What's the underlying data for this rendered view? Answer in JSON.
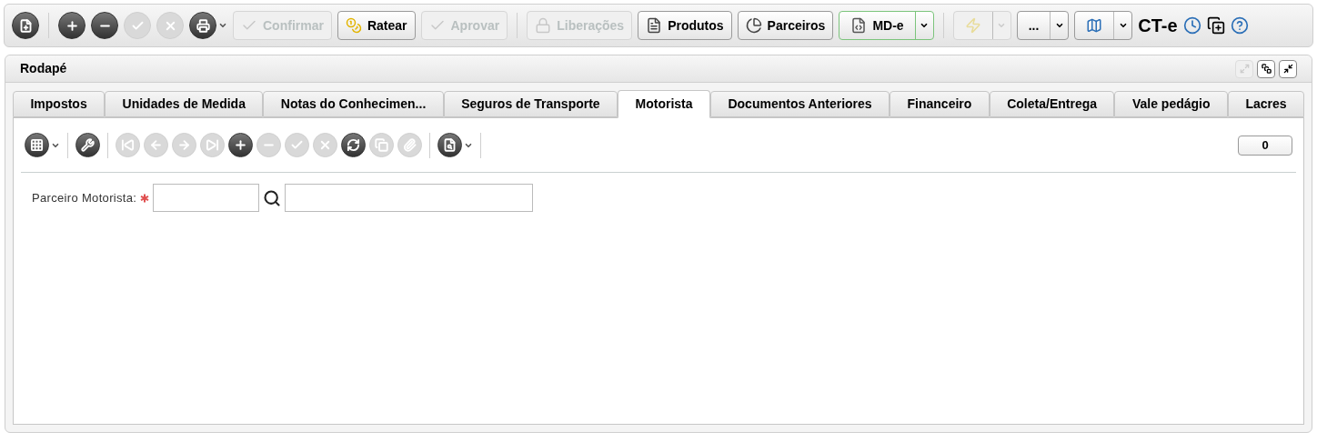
{
  "toolbar": {
    "items": [
      {
        "kind": "icon",
        "disabled": false
      },
      {
        "kind": "separator"
      },
      {
        "kind": "icon",
        "disabled": false
      },
      {
        "kind": "icon",
        "disabled": false
      },
      {
        "kind": "icon",
        "disabled": true
      },
      {
        "kind": "icon",
        "disabled": true
      },
      {
        "kind": "menu-icon",
        "disabled": false
      },
      {
        "kind": "button",
        "label": "Confirmar",
        "disabled": true
      },
      {
        "kind": "button",
        "label": "Ratear",
        "disabled": false
      },
      {
        "kind": "button",
        "label": "Aprovar",
        "disabled": true
      },
      {
        "kind": "separator"
      },
      {
        "kind": "button",
        "label": "Liberações",
        "disabled": true
      },
      {
        "kind": "button",
        "label": "Produtos",
        "disabled": false
      },
      {
        "kind": "button",
        "label": "Parceiros",
        "disabled": false
      },
      {
        "kind": "split",
        "label": "MD-e",
        "disabled": false,
        "highlighted": true
      },
      {
        "kind": "separator"
      },
      {
        "kind": "split",
        "disabled": true,
        "highlighted": false
      },
      {
        "kind": "split",
        "label": "...",
        "disabled": false,
        "highlighted": false
      },
      {
        "kind": "split",
        "disabled": false,
        "highlighted": false
      },
      {
        "kind": "label",
        "label": "CT-e"
      },
      {
        "kind": "small-icon",
        "disabled": false
      },
      {
        "kind": "small-icon",
        "disabled": false
      },
      {
        "kind": "small-icon",
        "disabled": false
      }
    ]
  },
  "panel": {
    "title": "Rodapé",
    "window_buttons": [
      {
        "disabled": true
      },
      {
        "disabled": false
      },
      {
        "disabled": false
      }
    ],
    "tabs": [
      {
        "label": "Impostos",
        "selected": false
      },
      {
        "label": "Unidades de Medida",
        "selected": false
      },
      {
        "label": "Notas do Conhecimen...",
        "selected": false
      },
      {
        "label": "Seguros de Transporte",
        "selected": false
      },
      {
        "label": "Motorista",
        "selected": true
      },
      {
        "label": "Documentos Anteriores",
        "selected": false
      },
      {
        "label": "Financeiro",
        "selected": false
      },
      {
        "label": "Coleta/Entrega",
        "selected": false
      },
      {
        "label": "Vale pedágio",
        "selected": false
      },
      {
        "label": "Lacres",
        "selected": false
      }
    ],
    "grid_toolbar": {
      "items": [
        {
          "kind": "menu-icon",
          "disabled": false
        },
        {
          "kind": "separator"
        },
        {
          "kind": "icon",
          "disabled": false
        },
        {
          "kind": "separator"
        },
        {
          "kind": "icon",
          "disabled": true
        },
        {
          "kind": "icon",
          "disabled": true
        },
        {
          "kind": "icon",
          "disabled": true
        },
        {
          "kind": "icon",
          "disabled": true
        },
        {
          "kind": "icon",
          "disabled": false
        },
        {
          "kind": "icon",
          "disabled": true
        },
        {
          "kind": "icon",
          "disabled": true
        },
        {
          "kind": "icon",
          "disabled": true
        },
        {
          "kind": "icon",
          "disabled": false
        },
        {
          "kind": "icon",
          "disabled": true
        },
        {
          "kind": "icon",
          "disabled": true
        },
        {
          "kind": "separator"
        },
        {
          "kind": "menu-icon",
          "disabled": false
        },
        {
          "kind": "separator"
        }
      ],
      "record_count": "0"
    },
    "form": {
      "fields": [
        {
          "label": "Parceiro Motorista:",
          "required": true
        }
      ]
    }
  }
}
